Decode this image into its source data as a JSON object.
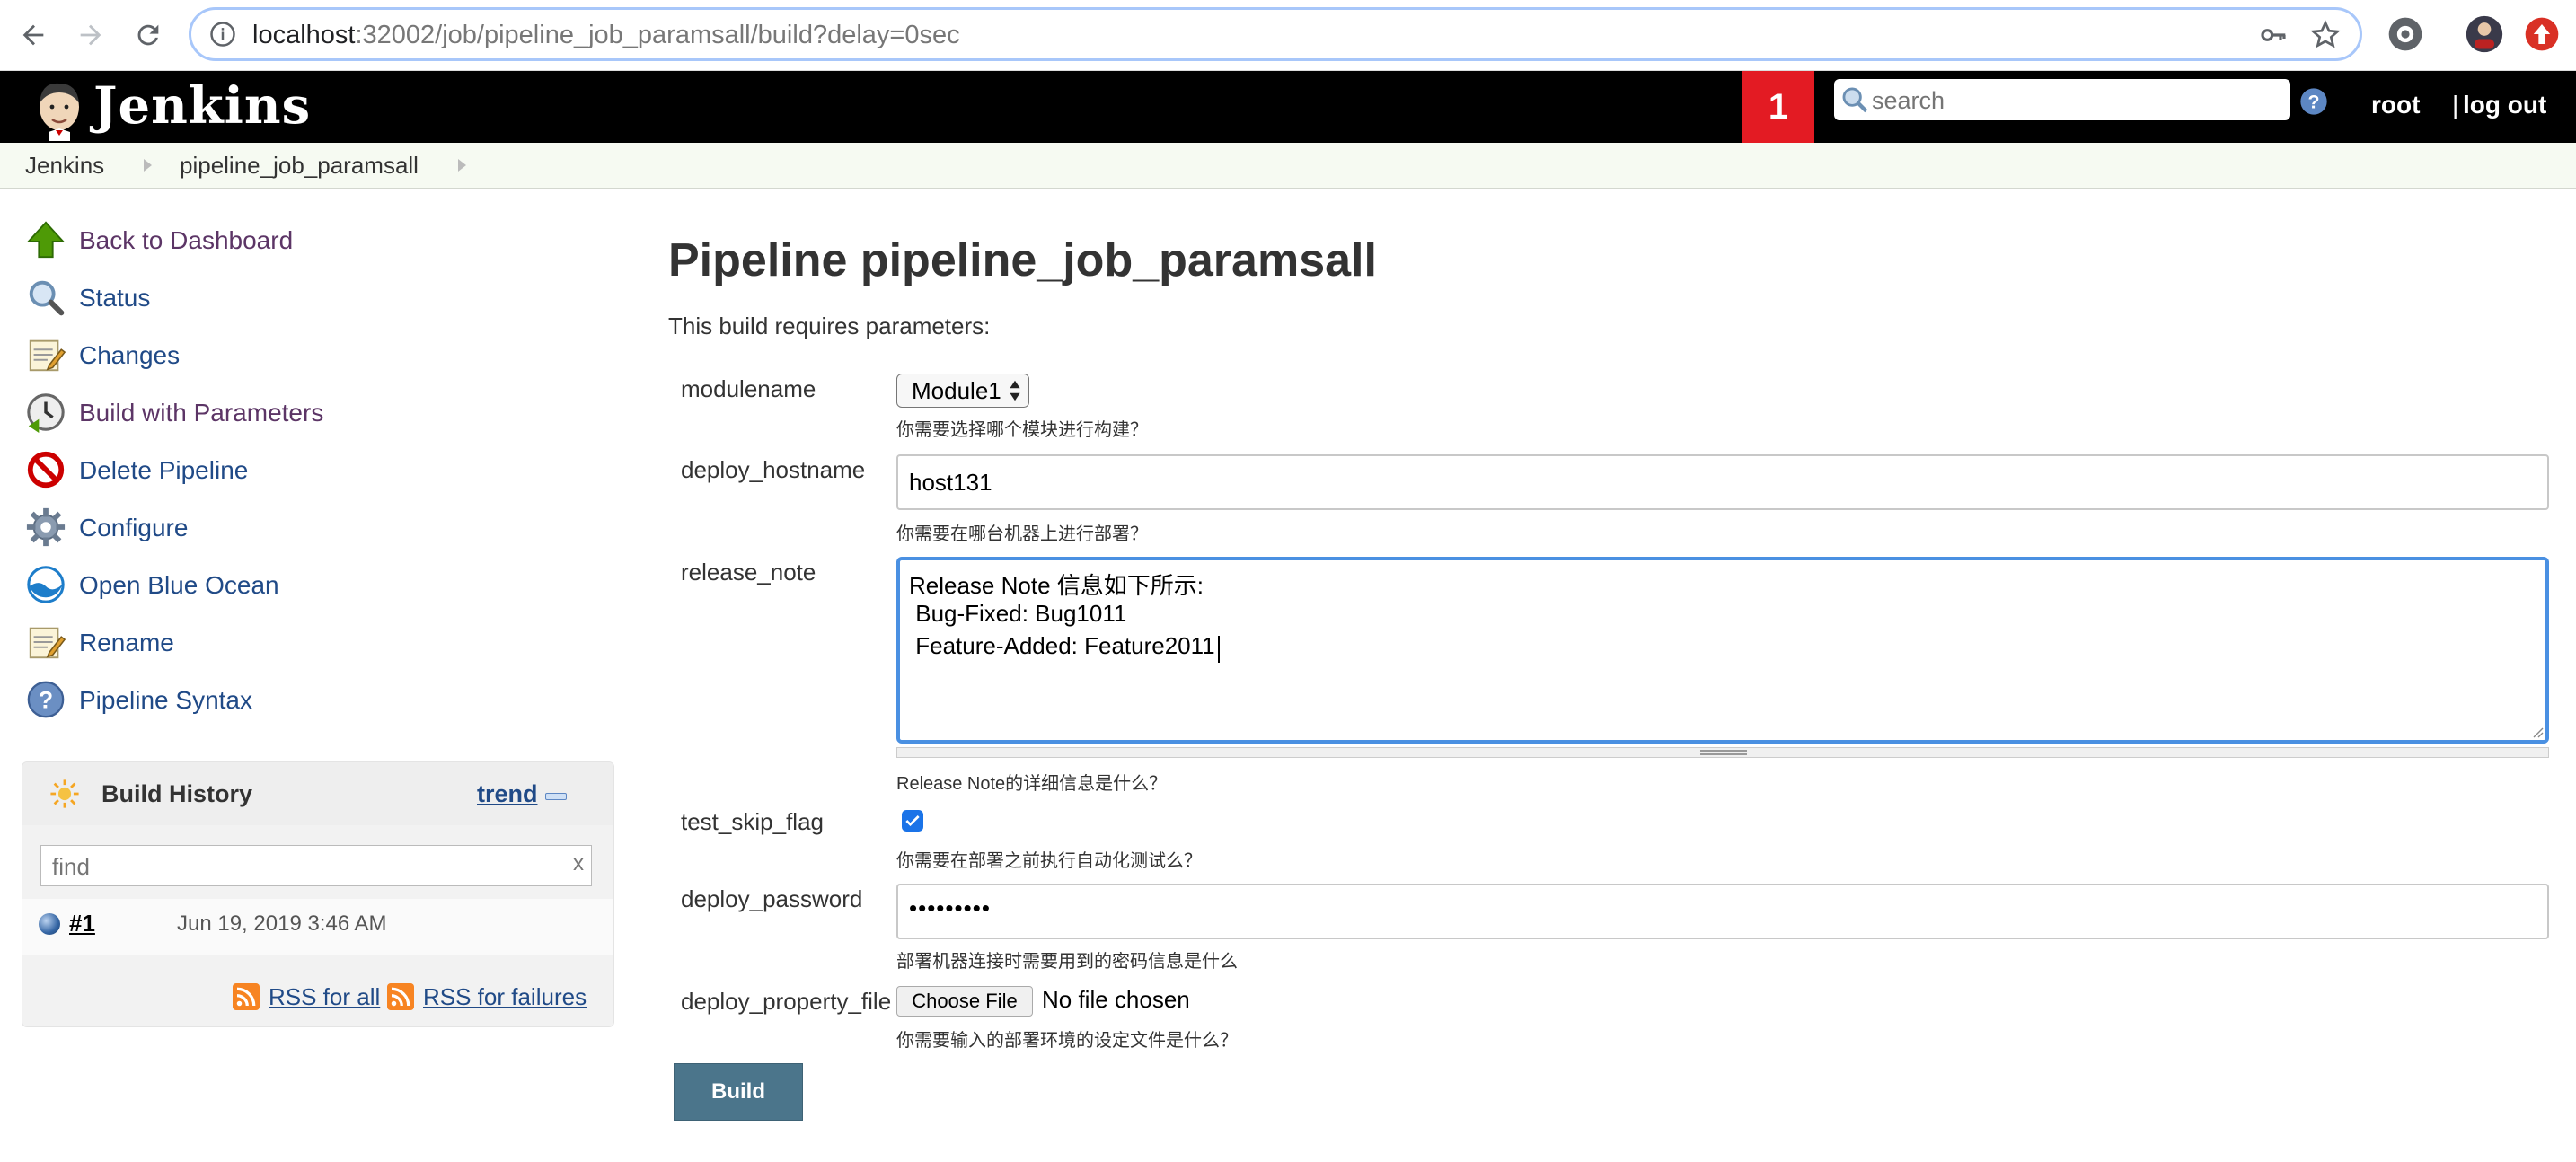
{
  "browser": {
    "url_host": "localhost",
    "url_rest": ":32002/job/pipeline_job_paramsall/build?delay=0sec"
  },
  "header": {
    "brand": "Jenkins",
    "notification_count": "1",
    "search_placeholder": "search",
    "user": "root",
    "separator": "|",
    "logout": "log out"
  },
  "breadcrumb": [
    "Jenkins",
    "pipeline_job_paramsall"
  ],
  "sidebar": {
    "tasks": [
      {
        "label": "Back to Dashboard",
        "icon": "up-arrow-icon"
      },
      {
        "label": "Status",
        "icon": "magnifier-icon"
      },
      {
        "label": "Changes",
        "icon": "notepad-icon"
      },
      {
        "label": "Build with Parameters",
        "icon": "clock-icon"
      },
      {
        "label": "Delete Pipeline",
        "icon": "no-entry-icon"
      },
      {
        "label": "Configure",
        "icon": "gear-icon"
      },
      {
        "label": "Open Blue Ocean",
        "icon": "blue-ocean-icon"
      },
      {
        "label": "Rename",
        "icon": "notepad-icon"
      },
      {
        "label": "Pipeline Syntax",
        "icon": "help-icon"
      }
    ]
  },
  "build_history": {
    "title": "Build History",
    "trend": "trend",
    "find_placeholder": "find",
    "find_clear": "x",
    "builds": [
      {
        "number": "#1",
        "date": "Jun 19, 2019 3:46 AM"
      }
    ],
    "rss_all": "RSS for all",
    "rss_failures": "RSS for failures"
  },
  "main": {
    "title": "Pipeline pipeline_job_paramsall",
    "intro": "This build requires parameters:",
    "params": {
      "modulename": {
        "label": "modulename",
        "value": "Module1",
        "description": "你需要选择哪个模块进行构建？"
      },
      "deploy_hostname": {
        "label": "deploy_hostname",
        "value": "host131",
        "description": "你需要在哪台机器上进行部署？"
      },
      "release_note": {
        "label": "release_note",
        "lines": [
          "Release Note 信息如下所示:",
          " Bug-Fixed: Bug1011",
          " Feature-Added: Feature2011"
        ],
        "description": "Release Note的详细信息是什么？"
      },
      "test_skip_flag": {
        "label": "test_skip_flag",
        "checked": true,
        "description": "你需要在部署之前执行自动化测试么？"
      },
      "deploy_password": {
        "label": "deploy_password",
        "value": "•••••••••",
        "description": "部署机器连接时需要用到的密码信息是什么"
      },
      "deploy_property_file": {
        "label": "deploy_property_file",
        "button": "Choose File",
        "status": "No file chosen",
        "description": "你需要输入的部署环境的设定文件是什么？"
      }
    },
    "build_button": "Build"
  },
  "colors": {
    "header_bg": "#000000",
    "notification_bg": "#e31b23",
    "link": "#204a87",
    "visited_link": "#5c3566",
    "focus_ring": "#4a90e2",
    "build_button": "#4b758b"
  }
}
